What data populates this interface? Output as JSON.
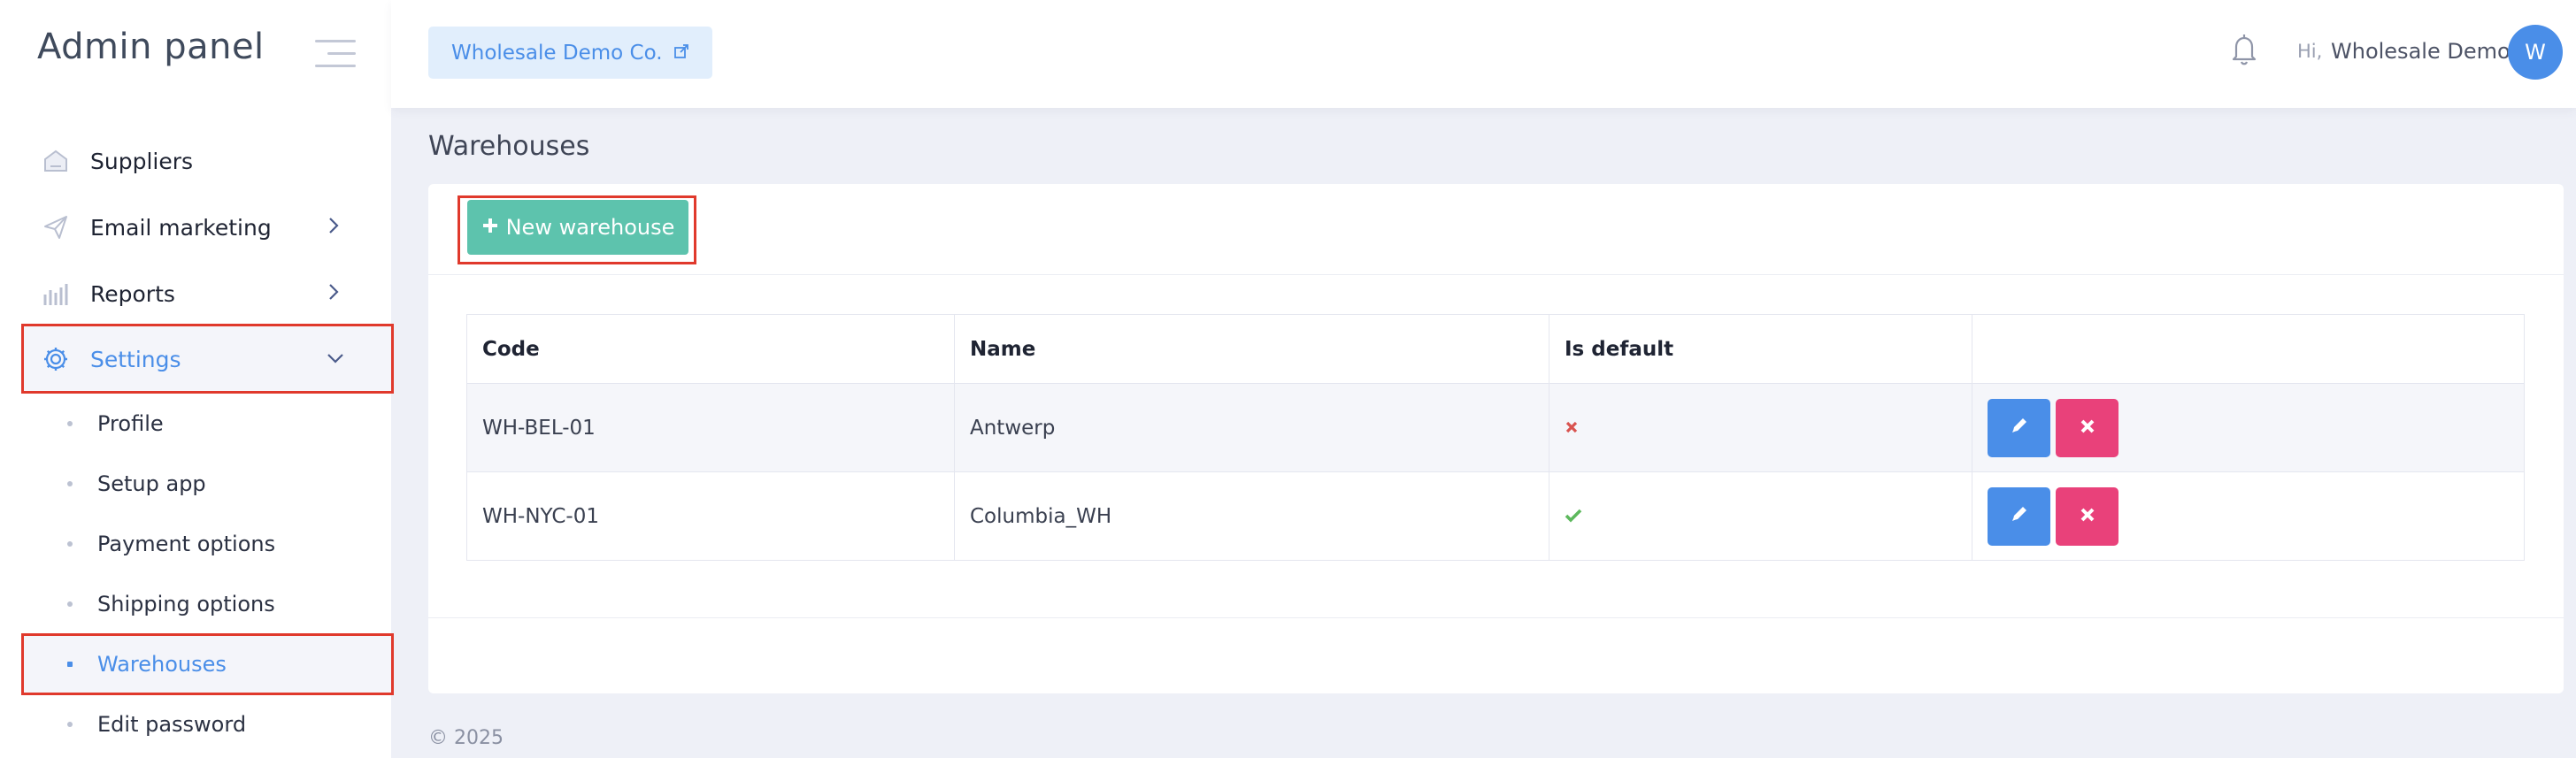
{
  "sidebar": {
    "brand": "Admin panel",
    "items": [
      {
        "label": "Suppliers",
        "icon": "home-icon"
      },
      {
        "label": "Email marketing",
        "icon": "send-icon"
      },
      {
        "label": "Reports",
        "icon": "bar-chart-icon"
      },
      {
        "label": "Settings",
        "icon": "gear-icon"
      }
    ],
    "submenu": [
      {
        "label": "Profile"
      },
      {
        "label": "Setup app"
      },
      {
        "label": "Payment options"
      },
      {
        "label": "Shipping options"
      },
      {
        "label": "Warehouses"
      },
      {
        "label": "Edit password"
      }
    ]
  },
  "header": {
    "company": "Wholesale Demo Co.",
    "greeting": "Hi,",
    "user_name": "Wholesale Demo",
    "avatar_initial": "W"
  },
  "main": {
    "title": "Warehouses",
    "new_button": "New warehouse",
    "table": {
      "columns": [
        "Code",
        "Name",
        "Is default",
        ""
      ],
      "rows": [
        {
          "code": "WH-BEL-01",
          "name": "Antwerp",
          "is_default": false
        },
        {
          "code": "WH-NYC-01",
          "name": "Columbia_WH",
          "is_default": true
        }
      ]
    }
  },
  "footer": "© 2025",
  "colors": {
    "accent": "#4a8ee8",
    "success": "#5dc3ad",
    "danger": "#e9417a",
    "highlight": "#e0392c"
  }
}
